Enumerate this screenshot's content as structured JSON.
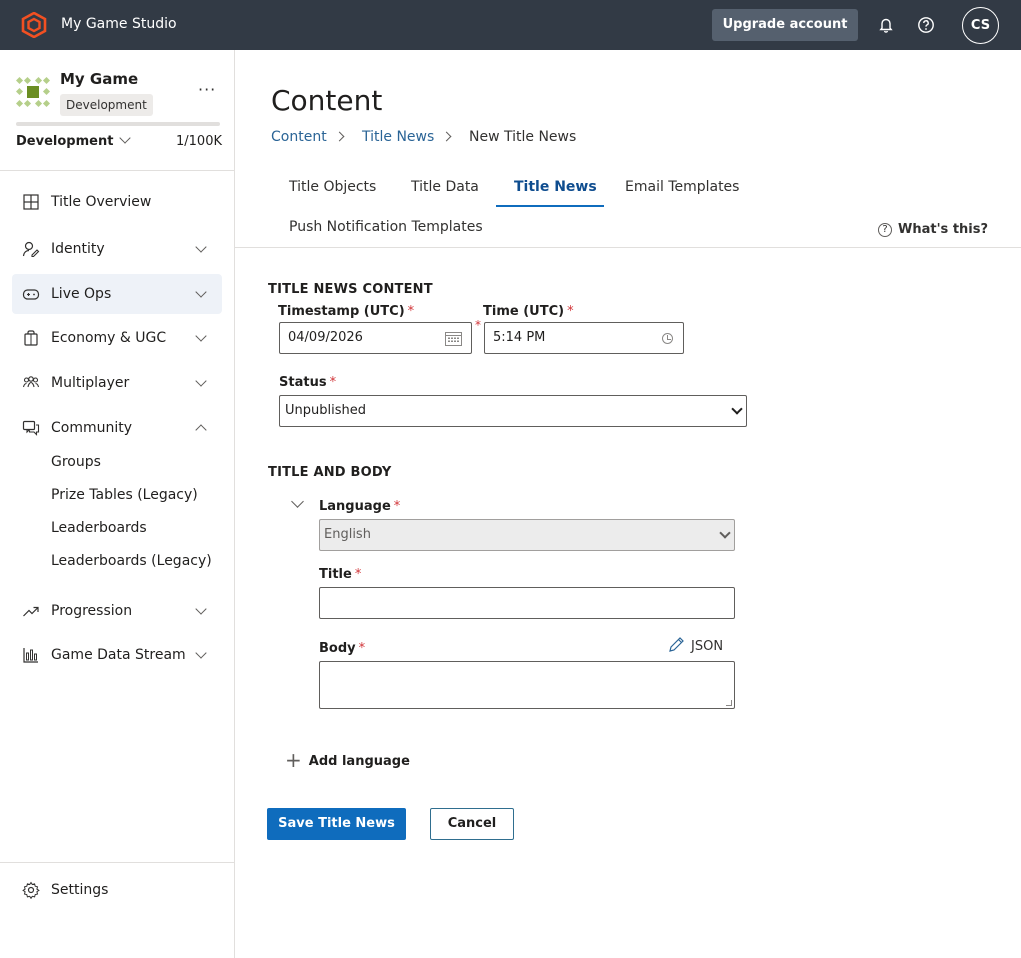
{
  "topbar": {
    "studio_name": "My Game Studio",
    "upgrade_label": "Upgrade account",
    "avatar_initials": "CS",
    "logo_color": "#f25022"
  },
  "sidebar": {
    "game_name": "My Game",
    "environment_badge": "Development",
    "environment_selected": "Development",
    "quota_text": "1/100K",
    "quota_fill_fraction": 1e-05,
    "nav": [
      {
        "label": "Title Overview",
        "icon": "grid-icon",
        "expandable": false
      },
      {
        "label": "Identity",
        "icon": "identity-icon",
        "expandable": true
      },
      {
        "label": "Live Ops",
        "icon": "gamepad-icon",
        "expandable": true,
        "active": true
      },
      {
        "label": "Economy & UGC",
        "icon": "bag-icon",
        "expandable": true
      },
      {
        "label": "Multiplayer",
        "icon": "people-icon",
        "expandable": true
      },
      {
        "label": "Community",
        "icon": "chat-icon",
        "expandable": true,
        "expanded": true
      },
      {
        "label": "Progression",
        "icon": "trending-icon",
        "expandable": true
      },
      {
        "label": "Game Data Stream",
        "icon": "bar-chart-icon",
        "expandable": true
      }
    ],
    "community_sub": [
      "Groups",
      "Prize Tables (Legacy)",
      "Leaderboards",
      "Leaderboards (Legacy)"
    ],
    "settings_label": "Settings"
  },
  "main": {
    "title": "Content",
    "breadcrumb": [
      "Content",
      "Title News",
      "New Title News"
    ],
    "tabs": [
      "Title Objects",
      "Title Data",
      "Title News",
      "Email Templates",
      "Push Notification Templates"
    ],
    "active_tab": "Title News",
    "whats_this": "What's this?",
    "section_content": "TITLE NEWS CONTENT",
    "timestamp_label": "Timestamp (UTC)",
    "timestamp_value": "04/09/2026",
    "time_label": "Time (UTC)",
    "time_value": "5:14 PM",
    "status_label": "Status",
    "status_value": "Unpublished",
    "section_body": "TITLE AND BODY",
    "language_label": "Language",
    "language_value": "English",
    "title_label": "Title",
    "title_value": "",
    "body_label": "Body",
    "body_value": "",
    "json_label": "JSON",
    "add_language_label": "Add language",
    "save_label": "Save Title News",
    "cancel_label": "Cancel",
    "required_mark": "*"
  },
  "colors": {
    "topbar_bg": "#323a45",
    "accent": "#0f6cbd",
    "link": "#2a6496",
    "required": "#d13438"
  }
}
